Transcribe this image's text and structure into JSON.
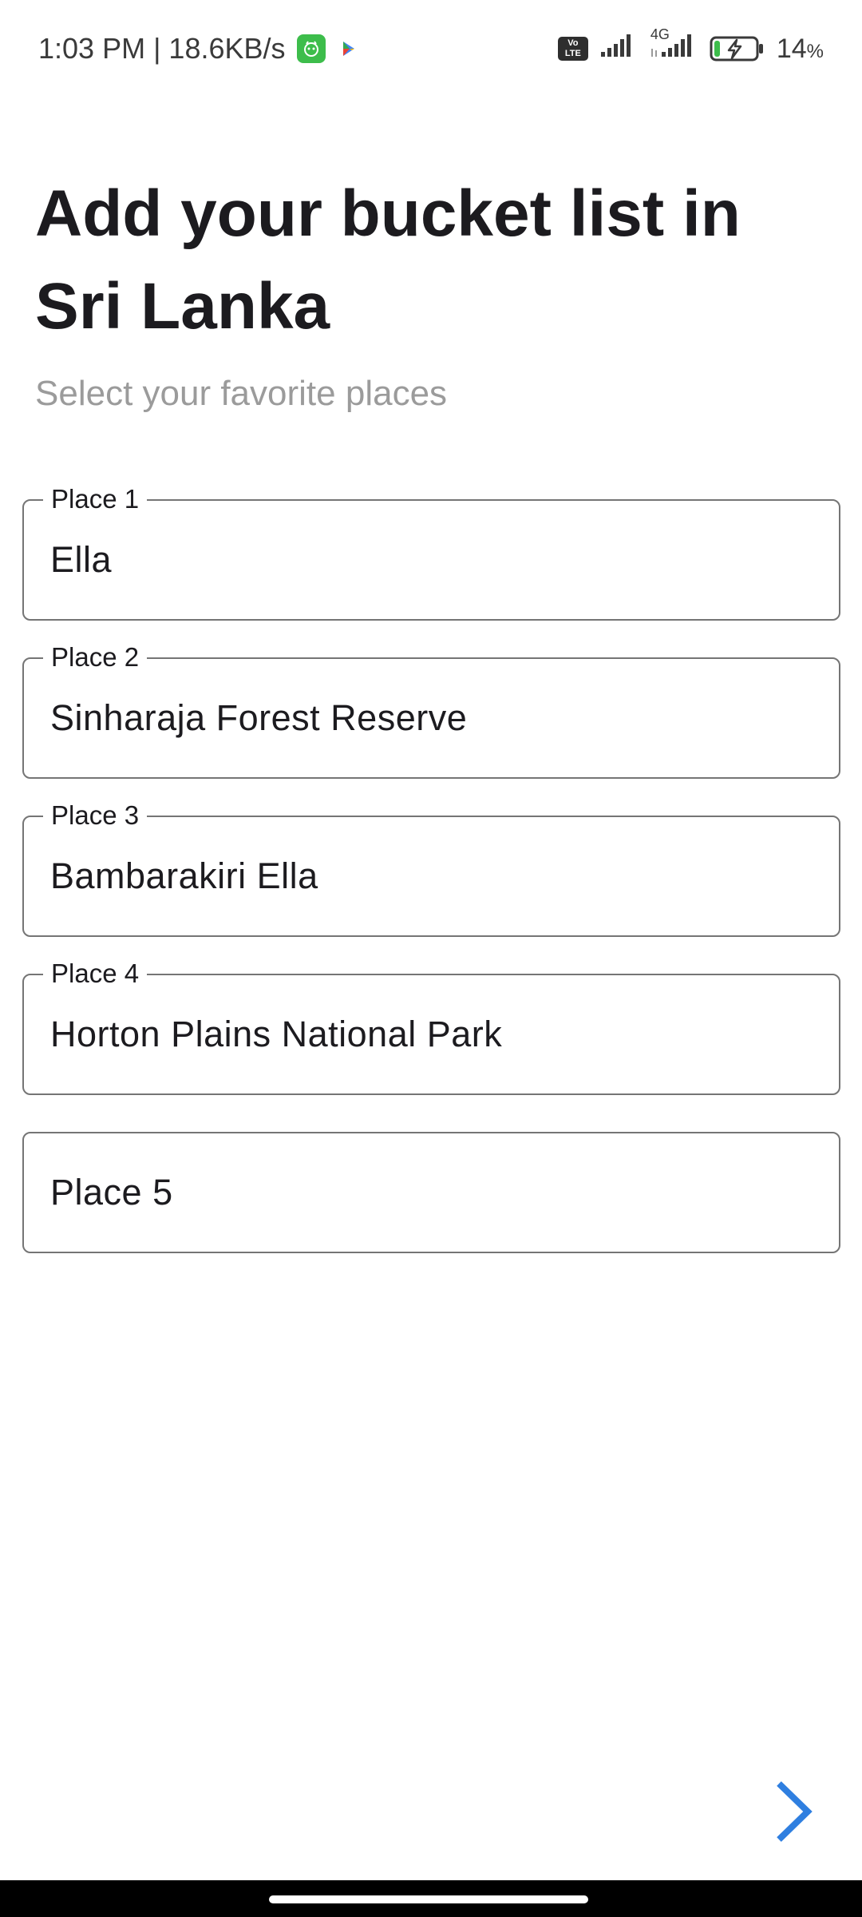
{
  "status_bar": {
    "time_speed": "1:03 PM | 18.6KB/s",
    "network_label": "4G",
    "volte_top": "Vo",
    "volte_bottom": "LTE",
    "battery_percent": "14",
    "battery_unit": "%",
    "battery_level": 0.14
  },
  "header": {
    "title": "Add your bucket list in Sri Lanka",
    "subtitle": "Select your favorite places"
  },
  "fields": [
    {
      "label": "Place 1",
      "value": "Ella"
    },
    {
      "label": "Place 2",
      "value": "Sinharaja Forest Reserve"
    },
    {
      "label": "Place 3",
      "value": "Bambarakiri Ella"
    },
    {
      "label": "Place 4",
      "value": "Horton Plains National Park"
    },
    {
      "label": "",
      "placeholder": "Place 5",
      "value": ""
    }
  ],
  "icons": {
    "next": "chevron-right-icon",
    "app_badge": "app-notification-icon",
    "play": "play-store-icon"
  },
  "colors": {
    "accent": "#2f7fe0",
    "title": "#1c1b1f",
    "subtitle": "#9b9b9b",
    "outline": "#757575",
    "battery_charge": "#3dbd4b"
  }
}
